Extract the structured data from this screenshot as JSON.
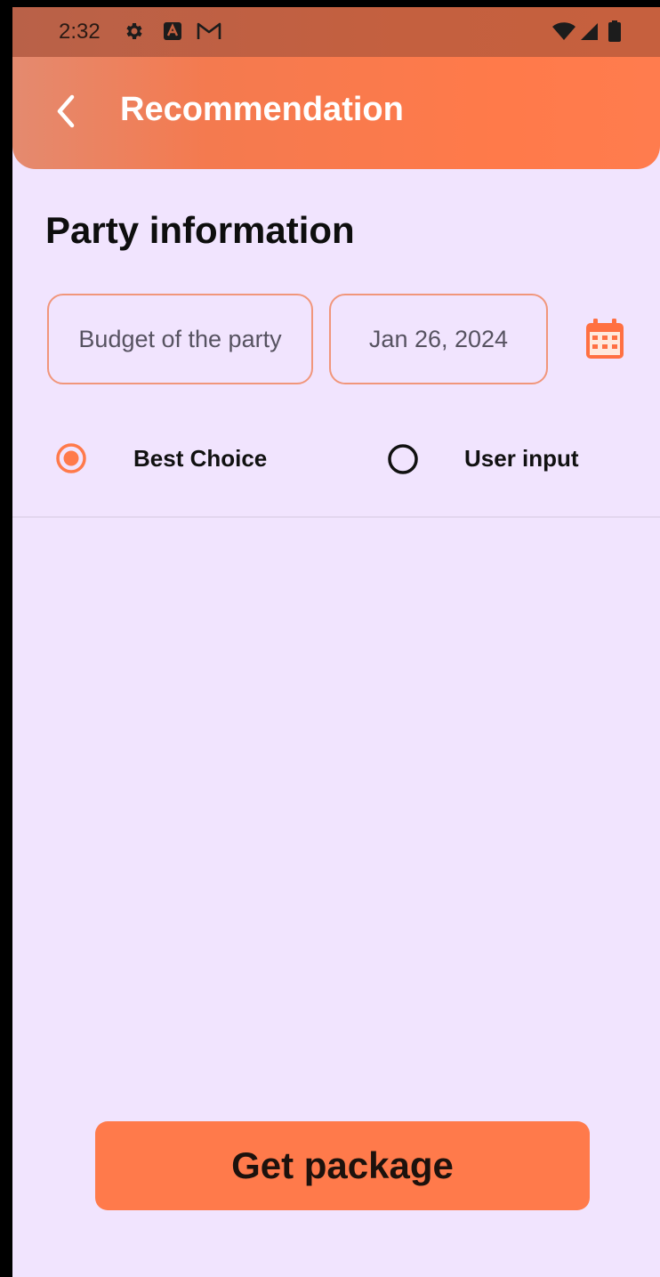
{
  "status_bar": {
    "time": "2:32",
    "icons": [
      "gear-icon",
      "a-square-icon",
      "gmail-icon",
      "wifi-icon",
      "signal-icon",
      "battery-icon"
    ]
  },
  "app_bar": {
    "title": "Recommendation",
    "back_icon": "chevron-left-icon"
  },
  "party_info": {
    "section_title": "Party information",
    "budget_field": {
      "placeholder": "Budget of the party",
      "value": ""
    },
    "date_field": {
      "value": "Jan 26, 2024"
    },
    "calendar_icon": "calendar-icon"
  },
  "choice": {
    "options": [
      {
        "label": "Best Choice",
        "selected": true
      },
      {
        "label": "User input",
        "selected": false
      }
    ]
  },
  "footer": {
    "get_package_label": "Get package"
  },
  "colors": {
    "accent": "#ff7a4b",
    "background": "#f1e4fe",
    "field_border": "#f1967b",
    "calendar": "#ff7042"
  }
}
